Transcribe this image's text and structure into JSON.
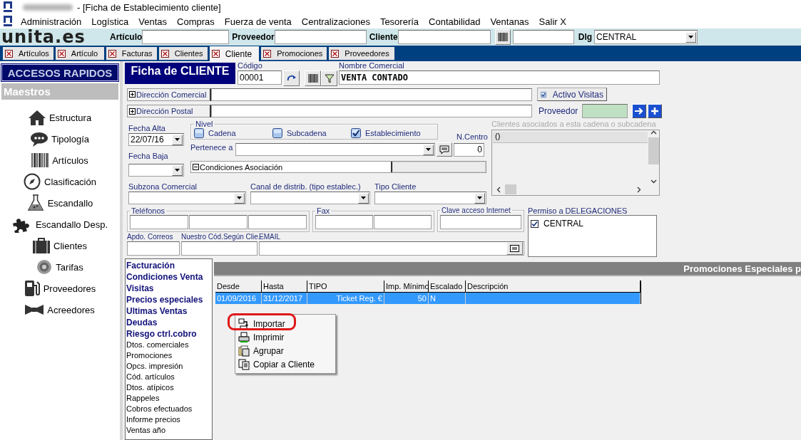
{
  "window": {
    "title": "- [Ficha de Establecimiento cliente]"
  },
  "menu": [
    "Administración",
    "Logística",
    "Ventas",
    "Compras",
    "Fuerza de venta",
    "Centralizaciones",
    "Tesorería",
    "Contabilidad",
    "Ventanas",
    "Salir X"
  ],
  "toolbar": {
    "logo": "unita.es",
    "fields": [
      {
        "label": "Artículo"
      },
      {
        "label": "Proveedor"
      },
      {
        "label": "Cliente"
      }
    ],
    "dlg": {
      "label": "Dlg",
      "value": "CENTRAL"
    }
  },
  "tabs": [
    {
      "label": "Artículos",
      "selected": false
    },
    {
      "label": "Artículo",
      "selected": false
    },
    {
      "label": "Facturas",
      "selected": false
    },
    {
      "label": "Clientes",
      "selected": false
    },
    {
      "label": "Cliente",
      "selected": true
    },
    {
      "label": "Promociones",
      "selected": false
    },
    {
      "label": "Proveedores",
      "selected": false
    }
  ],
  "sidebar": {
    "title": "ACCESOS RAPIDOS",
    "section": "Maestros",
    "items": [
      {
        "label": "Estructura",
        "kind": "house"
      },
      {
        "label": "Tipología",
        "kind": "chat"
      },
      {
        "label": "Artículos",
        "kind": "barcode"
      },
      {
        "label": "Clasificación",
        "kind": "compass"
      },
      {
        "label": "Escandallo",
        "kind": "flask"
      },
      {
        "label": "Escandallo Desp.",
        "kind": "puzzle"
      },
      {
        "label": "Clientes",
        "kind": "briefcase"
      },
      {
        "label": "Tarifas",
        "kind": "coin"
      },
      {
        "label": "Proveedores",
        "kind": "fuel"
      },
      {
        "label": "Acreedores",
        "kind": "bowtie"
      }
    ]
  },
  "form": {
    "title": "Ficha de CLIENTE",
    "codigo": {
      "label": "Código",
      "value": "00001"
    },
    "nombre": {
      "label": "Nombre Comercial",
      "value": "VENTA CONTADO"
    },
    "direccion_comercial": {
      "label": "Dirección Comercial"
    },
    "direccion_postal": {
      "label": "Dirección Postal"
    },
    "activo_visitas": {
      "label": "Activo Visitas",
      "checked": true
    },
    "proveedor": {
      "label": "Proveedor"
    },
    "fecha_alta": {
      "label": "Fecha Alta",
      "value": "22/07/16"
    },
    "fecha_baja": {
      "label": "Fecha Baja"
    },
    "nivel": {
      "label": "Nivel",
      "options": [
        {
          "label": "Cadena",
          "checked": false
        },
        {
          "label": "Subcadena",
          "checked": false
        },
        {
          "label": "Establecimiento",
          "checked": true
        }
      ]
    },
    "n_centro": {
      "label": "N.Centro",
      "value": "0"
    },
    "pertenece": {
      "label": "Pertenece a"
    },
    "condiciones": {
      "label": "Condiciones Asociación"
    },
    "clientes_asociados": {
      "label": "Clientes asociados a esta cadena o subcadena",
      "rows": [
        "()"
      ]
    },
    "subzona": {
      "label": "Subzona Comercial"
    },
    "canal": {
      "label": "Canal de distrib. (tipo establec.)"
    },
    "tipo_cliente": {
      "label": "Tipo Cliente"
    },
    "telefonos": {
      "label": "Teléfonos"
    },
    "fax": {
      "label": "Fax"
    },
    "clave": {
      "label": "Clave acceso Internet"
    },
    "permiso": {
      "label": "Permiso a DELEGACIONES",
      "items": [
        {
          "label": "CENTRAL",
          "checked": true
        }
      ]
    },
    "apdo": {
      "label": "Apdo. Correos"
    },
    "nuestro_cod": {
      "label": "Nuestro Cód.Según Clie."
    },
    "email": {
      "label": "EMAIL"
    }
  },
  "links": [
    {
      "label": "Facturación",
      "bold": true
    },
    {
      "label": "Condiciones Venta",
      "bold": true
    },
    {
      "label": "Visitas",
      "bold": true
    },
    {
      "label": "Precios especiales",
      "bold": true
    },
    {
      "label": "Ultimas Ventas",
      "bold": true
    },
    {
      "label": "Deudas",
      "bold": true
    },
    {
      "label": "Riesgo ctrl.cobro",
      "bold": true
    },
    {
      "label": "Dtos. comerciales",
      "bold": false
    },
    {
      "label": "Promociones",
      "bold": false
    },
    {
      "label": "Opcs. impresión",
      "bold": false
    },
    {
      "label": "Cód. artículos",
      "bold": false
    },
    {
      "label": "Dtos. atípicos",
      "bold": false
    },
    {
      "label": "Rappeles",
      "bold": false
    },
    {
      "label": "Cobros efectuados",
      "bold": false
    },
    {
      "label": "Informe precios",
      "bold": false
    },
    {
      "label": "Ventas año",
      "bold": false
    }
  ],
  "promo_panel": {
    "title": "Promociones Especiales p",
    "table": {
      "columns": [
        "Desde",
        "Hasta",
        "TIPO",
        "Imp. Mínimo",
        "Escalado",
        "Descripción"
      ],
      "rows": [
        {
          "cells": [
            "01/09/2016",
            "31/12/2017",
            "Ticket Reg. €",
            "50",
            "N"
          ],
          "selected": true
        }
      ]
    }
  },
  "context_menu": {
    "items": [
      {
        "label": "Importar",
        "kind": "import",
        "highlighted": true
      },
      {
        "label": "Imprimir",
        "kind": "print",
        "highlighted": false
      },
      {
        "label": "Agrupar",
        "kind": "group",
        "highlighted": false
      },
      {
        "label": "Copiar a Cliente",
        "kind": "copy",
        "highlighted": false
      }
    ]
  }
}
